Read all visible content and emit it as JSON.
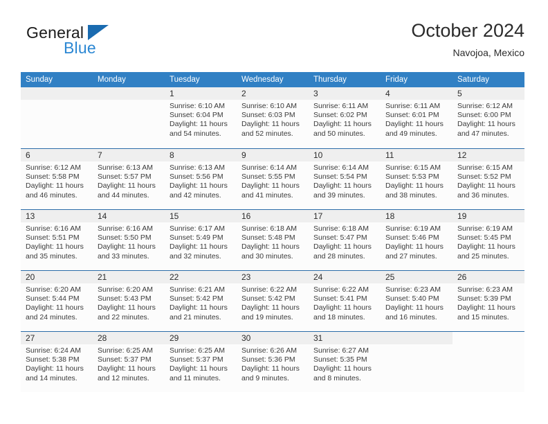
{
  "logo": {
    "word_top": "General",
    "word_bottom": "Blue",
    "triangle_color": "#1a6bb0",
    "blue_text_color": "#2b87d3"
  },
  "header": {
    "title": "October 2024",
    "subtitle": "Navojoa, Mexico"
  },
  "theme": {
    "header_bar": "#3180c4",
    "row_separator": "#2b6ca8",
    "daynum_strip": "#efefef",
    "cell_background": "#fcfcfc",
    "text": "#2b2b2b"
  },
  "weekday_headers": [
    "Sunday",
    "Monday",
    "Tuesday",
    "Wednesday",
    "Thursday",
    "Friday",
    "Saturday"
  ],
  "weeks": [
    [
      {
        "day": "",
        "lines": []
      },
      {
        "day": "",
        "lines": []
      },
      {
        "day": "1",
        "lines": [
          "Sunrise: 6:10 AM",
          "Sunset: 6:04 PM",
          "Daylight: 11 hours",
          "and 54 minutes."
        ]
      },
      {
        "day": "2",
        "lines": [
          "Sunrise: 6:10 AM",
          "Sunset: 6:03 PM",
          "Daylight: 11 hours",
          "and 52 minutes."
        ]
      },
      {
        "day": "3",
        "lines": [
          "Sunrise: 6:11 AM",
          "Sunset: 6:02 PM",
          "Daylight: 11 hours",
          "and 50 minutes."
        ]
      },
      {
        "day": "4",
        "lines": [
          "Sunrise: 6:11 AM",
          "Sunset: 6:01 PM",
          "Daylight: 11 hours",
          "and 49 minutes."
        ]
      },
      {
        "day": "5",
        "lines": [
          "Sunrise: 6:12 AM",
          "Sunset: 6:00 PM",
          "Daylight: 11 hours",
          "and 47 minutes."
        ]
      }
    ],
    [
      {
        "day": "6",
        "lines": [
          "Sunrise: 6:12 AM",
          "Sunset: 5:58 PM",
          "Daylight: 11 hours",
          "and 46 minutes."
        ]
      },
      {
        "day": "7",
        "lines": [
          "Sunrise: 6:13 AM",
          "Sunset: 5:57 PM",
          "Daylight: 11 hours",
          "and 44 minutes."
        ]
      },
      {
        "day": "8",
        "lines": [
          "Sunrise: 6:13 AM",
          "Sunset: 5:56 PM",
          "Daylight: 11 hours",
          "and 42 minutes."
        ]
      },
      {
        "day": "9",
        "lines": [
          "Sunrise: 6:14 AM",
          "Sunset: 5:55 PM",
          "Daylight: 11 hours",
          "and 41 minutes."
        ]
      },
      {
        "day": "10",
        "lines": [
          "Sunrise: 6:14 AM",
          "Sunset: 5:54 PM",
          "Daylight: 11 hours",
          "and 39 minutes."
        ]
      },
      {
        "day": "11",
        "lines": [
          "Sunrise: 6:15 AM",
          "Sunset: 5:53 PM",
          "Daylight: 11 hours",
          "and 38 minutes."
        ]
      },
      {
        "day": "12",
        "lines": [
          "Sunrise: 6:15 AM",
          "Sunset: 5:52 PM",
          "Daylight: 11 hours",
          "and 36 minutes."
        ]
      }
    ],
    [
      {
        "day": "13",
        "lines": [
          "Sunrise: 6:16 AM",
          "Sunset: 5:51 PM",
          "Daylight: 11 hours",
          "and 35 minutes."
        ]
      },
      {
        "day": "14",
        "lines": [
          "Sunrise: 6:16 AM",
          "Sunset: 5:50 PM",
          "Daylight: 11 hours",
          "and 33 minutes."
        ]
      },
      {
        "day": "15",
        "lines": [
          "Sunrise: 6:17 AM",
          "Sunset: 5:49 PM",
          "Daylight: 11 hours",
          "and 32 minutes."
        ]
      },
      {
        "day": "16",
        "lines": [
          "Sunrise: 6:18 AM",
          "Sunset: 5:48 PM",
          "Daylight: 11 hours",
          "and 30 minutes."
        ]
      },
      {
        "day": "17",
        "lines": [
          "Sunrise: 6:18 AM",
          "Sunset: 5:47 PM",
          "Daylight: 11 hours",
          "and 28 minutes."
        ]
      },
      {
        "day": "18",
        "lines": [
          "Sunrise: 6:19 AM",
          "Sunset: 5:46 PM",
          "Daylight: 11 hours",
          "and 27 minutes."
        ]
      },
      {
        "day": "19",
        "lines": [
          "Sunrise: 6:19 AM",
          "Sunset: 5:45 PM",
          "Daylight: 11 hours",
          "and 25 minutes."
        ]
      }
    ],
    [
      {
        "day": "20",
        "lines": [
          "Sunrise: 6:20 AM",
          "Sunset: 5:44 PM",
          "Daylight: 11 hours",
          "and 24 minutes."
        ]
      },
      {
        "day": "21",
        "lines": [
          "Sunrise: 6:20 AM",
          "Sunset: 5:43 PM",
          "Daylight: 11 hours",
          "and 22 minutes."
        ]
      },
      {
        "day": "22",
        "lines": [
          "Sunrise: 6:21 AM",
          "Sunset: 5:42 PM",
          "Daylight: 11 hours",
          "and 21 minutes."
        ]
      },
      {
        "day": "23",
        "lines": [
          "Sunrise: 6:22 AM",
          "Sunset: 5:42 PM",
          "Daylight: 11 hours",
          "and 19 minutes."
        ]
      },
      {
        "day": "24",
        "lines": [
          "Sunrise: 6:22 AM",
          "Sunset: 5:41 PM",
          "Daylight: 11 hours",
          "and 18 minutes."
        ]
      },
      {
        "day": "25",
        "lines": [
          "Sunrise: 6:23 AM",
          "Sunset: 5:40 PM",
          "Daylight: 11 hours",
          "and 16 minutes."
        ]
      },
      {
        "day": "26",
        "lines": [
          "Sunrise: 6:23 AM",
          "Sunset: 5:39 PM",
          "Daylight: 11 hours",
          "and 15 minutes."
        ]
      }
    ],
    [
      {
        "day": "27",
        "lines": [
          "Sunrise: 6:24 AM",
          "Sunset: 5:38 PM",
          "Daylight: 11 hours",
          "and 14 minutes."
        ]
      },
      {
        "day": "28",
        "lines": [
          "Sunrise: 6:25 AM",
          "Sunset: 5:37 PM",
          "Daylight: 11 hours",
          "and 12 minutes."
        ]
      },
      {
        "day": "29",
        "lines": [
          "Sunrise: 6:25 AM",
          "Sunset: 5:37 PM",
          "Daylight: 11 hours",
          "and 11 minutes."
        ]
      },
      {
        "day": "30",
        "lines": [
          "Sunrise: 6:26 AM",
          "Sunset: 5:36 PM",
          "Daylight: 11 hours",
          "and 9 minutes."
        ]
      },
      {
        "day": "31",
        "lines": [
          "Sunrise: 6:27 AM",
          "Sunset: 5:35 PM",
          "Daylight: 11 hours",
          "and 8 minutes."
        ]
      },
      {
        "day": "",
        "lines": []
      },
      {
        "day": "",
        "lines": [],
        "no_strip": true
      }
    ]
  ]
}
